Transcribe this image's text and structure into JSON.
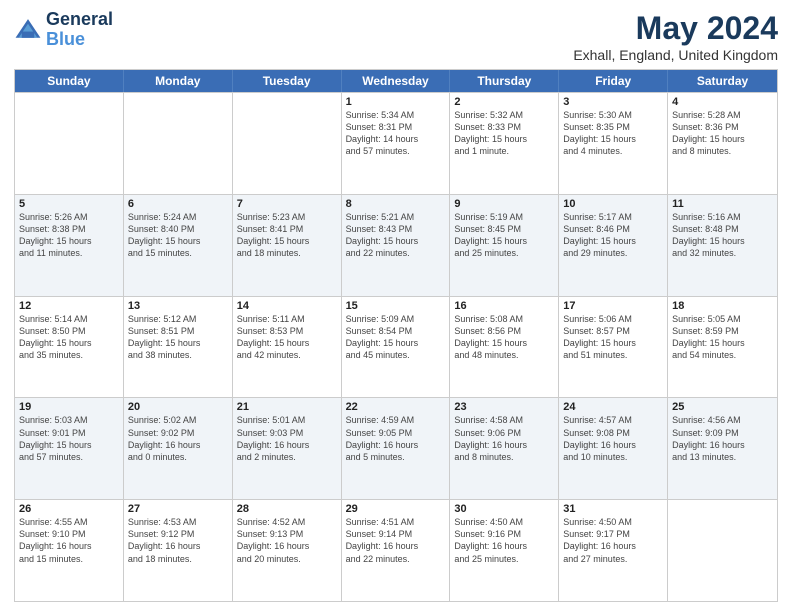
{
  "header": {
    "logo_line1": "General",
    "logo_line2": "Blue",
    "title": "May 2024",
    "subtitle": "Exhall, England, United Kingdom"
  },
  "day_headers": [
    "Sunday",
    "Monday",
    "Tuesday",
    "Wednesday",
    "Thursday",
    "Friday",
    "Saturday"
  ],
  "weeks": [
    [
      {
        "num": "",
        "info": "",
        "empty": true
      },
      {
        "num": "",
        "info": "",
        "empty": true
      },
      {
        "num": "",
        "info": "",
        "empty": true
      },
      {
        "num": "1",
        "info": "Sunrise: 5:34 AM\nSunset: 8:31 PM\nDaylight: 14 hours\nand 57 minutes."
      },
      {
        "num": "2",
        "info": "Sunrise: 5:32 AM\nSunset: 8:33 PM\nDaylight: 15 hours\nand 1 minute."
      },
      {
        "num": "3",
        "info": "Sunrise: 5:30 AM\nSunset: 8:35 PM\nDaylight: 15 hours\nand 4 minutes."
      },
      {
        "num": "4",
        "info": "Sunrise: 5:28 AM\nSunset: 8:36 PM\nDaylight: 15 hours\nand 8 minutes."
      }
    ],
    [
      {
        "num": "5",
        "info": "Sunrise: 5:26 AM\nSunset: 8:38 PM\nDaylight: 15 hours\nand 11 minutes."
      },
      {
        "num": "6",
        "info": "Sunrise: 5:24 AM\nSunset: 8:40 PM\nDaylight: 15 hours\nand 15 minutes."
      },
      {
        "num": "7",
        "info": "Sunrise: 5:23 AM\nSunset: 8:41 PM\nDaylight: 15 hours\nand 18 minutes."
      },
      {
        "num": "8",
        "info": "Sunrise: 5:21 AM\nSunset: 8:43 PM\nDaylight: 15 hours\nand 22 minutes."
      },
      {
        "num": "9",
        "info": "Sunrise: 5:19 AM\nSunset: 8:45 PM\nDaylight: 15 hours\nand 25 minutes."
      },
      {
        "num": "10",
        "info": "Sunrise: 5:17 AM\nSunset: 8:46 PM\nDaylight: 15 hours\nand 29 minutes."
      },
      {
        "num": "11",
        "info": "Sunrise: 5:16 AM\nSunset: 8:48 PM\nDaylight: 15 hours\nand 32 minutes."
      }
    ],
    [
      {
        "num": "12",
        "info": "Sunrise: 5:14 AM\nSunset: 8:50 PM\nDaylight: 15 hours\nand 35 minutes."
      },
      {
        "num": "13",
        "info": "Sunrise: 5:12 AM\nSunset: 8:51 PM\nDaylight: 15 hours\nand 38 minutes."
      },
      {
        "num": "14",
        "info": "Sunrise: 5:11 AM\nSunset: 8:53 PM\nDaylight: 15 hours\nand 42 minutes."
      },
      {
        "num": "15",
        "info": "Sunrise: 5:09 AM\nSunset: 8:54 PM\nDaylight: 15 hours\nand 45 minutes."
      },
      {
        "num": "16",
        "info": "Sunrise: 5:08 AM\nSunset: 8:56 PM\nDaylight: 15 hours\nand 48 minutes."
      },
      {
        "num": "17",
        "info": "Sunrise: 5:06 AM\nSunset: 8:57 PM\nDaylight: 15 hours\nand 51 minutes."
      },
      {
        "num": "18",
        "info": "Sunrise: 5:05 AM\nSunset: 8:59 PM\nDaylight: 15 hours\nand 54 minutes."
      }
    ],
    [
      {
        "num": "19",
        "info": "Sunrise: 5:03 AM\nSunset: 9:01 PM\nDaylight: 15 hours\nand 57 minutes."
      },
      {
        "num": "20",
        "info": "Sunrise: 5:02 AM\nSunset: 9:02 PM\nDaylight: 16 hours\nand 0 minutes."
      },
      {
        "num": "21",
        "info": "Sunrise: 5:01 AM\nSunset: 9:03 PM\nDaylight: 16 hours\nand 2 minutes."
      },
      {
        "num": "22",
        "info": "Sunrise: 4:59 AM\nSunset: 9:05 PM\nDaylight: 16 hours\nand 5 minutes."
      },
      {
        "num": "23",
        "info": "Sunrise: 4:58 AM\nSunset: 9:06 PM\nDaylight: 16 hours\nand 8 minutes."
      },
      {
        "num": "24",
        "info": "Sunrise: 4:57 AM\nSunset: 9:08 PM\nDaylight: 16 hours\nand 10 minutes."
      },
      {
        "num": "25",
        "info": "Sunrise: 4:56 AM\nSunset: 9:09 PM\nDaylight: 16 hours\nand 13 minutes."
      }
    ],
    [
      {
        "num": "26",
        "info": "Sunrise: 4:55 AM\nSunset: 9:10 PM\nDaylight: 16 hours\nand 15 minutes."
      },
      {
        "num": "27",
        "info": "Sunrise: 4:53 AM\nSunset: 9:12 PM\nDaylight: 16 hours\nand 18 minutes."
      },
      {
        "num": "28",
        "info": "Sunrise: 4:52 AM\nSunset: 9:13 PM\nDaylight: 16 hours\nand 20 minutes."
      },
      {
        "num": "29",
        "info": "Sunrise: 4:51 AM\nSunset: 9:14 PM\nDaylight: 16 hours\nand 22 minutes."
      },
      {
        "num": "30",
        "info": "Sunrise: 4:50 AM\nSunset: 9:16 PM\nDaylight: 16 hours\nand 25 minutes."
      },
      {
        "num": "31",
        "info": "Sunrise: 4:50 AM\nSunset: 9:17 PM\nDaylight: 16 hours\nand 27 minutes."
      },
      {
        "num": "",
        "info": "",
        "empty": true
      }
    ]
  ]
}
